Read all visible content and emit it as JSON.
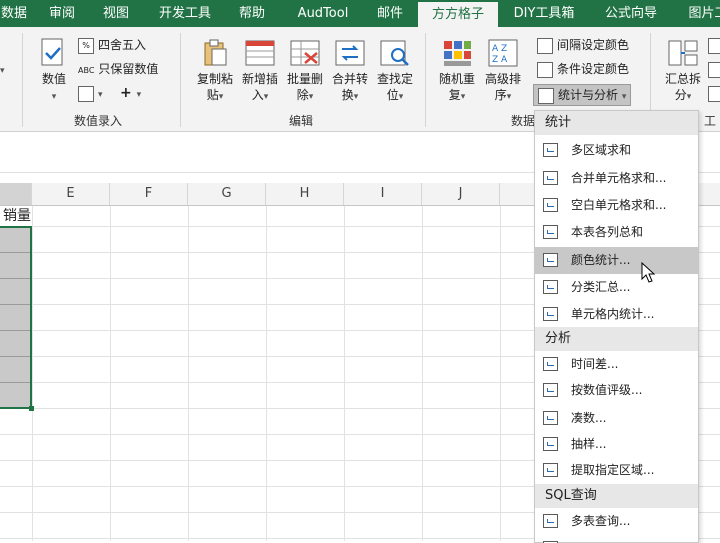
{
  "tabs": [
    {
      "label": "数据",
      "active": false
    },
    {
      "label": "审阅",
      "active": false
    },
    {
      "label": "视图",
      "active": false
    },
    {
      "label": "开发工具",
      "active": false
    },
    {
      "label": "帮助",
      "active": false
    },
    {
      "label": "AudTool",
      "active": false
    },
    {
      "label": "邮件",
      "active": false
    },
    {
      "label": "方方格子",
      "active": true
    },
    {
      "label": "DIY工具箱",
      "active": false
    },
    {
      "label": "公式向导",
      "active": false
    },
    {
      "label": "图片工",
      "active": false
    }
  ],
  "ribbon": {
    "group_numeric": {
      "label": "数值录入",
      "value_button": "数值",
      "round_button": "四舍五入",
      "keep_values_button": "只保留数值",
      "plus_symbol": "+"
    },
    "group_edit": {
      "label": "编辑",
      "copy_paste": {
        "line1": "复制粘",
        "line2": "贴"
      },
      "new_insert": {
        "line1": "新增插",
        "line2": "入"
      },
      "batch_delete": {
        "line1": "批量删",
        "line2": "除"
      },
      "merge_convert": {
        "line1": "合并转",
        "line2": "换"
      },
      "find_locate": {
        "line1": "查找定",
        "line2": "位"
      }
    },
    "group_data": {
      "label": "数据",
      "random_repeat": {
        "line1": "随机重",
        "line2": "复"
      },
      "advanced_sort": {
        "line1": "高级排",
        "line2": "序"
      },
      "interval_color": "间隔设定颜色",
      "cond_color": "条件设定颜色",
      "stats_analysis": "统计与分析"
    },
    "group_work": {
      "label": "工",
      "summary_split": {
        "line1": "汇总拆",
        "line2": "分"
      }
    }
  },
  "columns": [
    "E",
    "F",
    "G",
    "H",
    "I",
    "J"
  ],
  "cell_header": "销量",
  "menu": {
    "sections": [
      {
        "title": "统计",
        "items": [
          "多区域求和",
          "合并单元格求和...",
          "空白单元格求和...",
          "本表各列总和",
          "颜色统计...",
          "分类汇总...",
          "单元格内统计..."
        ]
      },
      {
        "title": "分析",
        "items": [
          "时间差...",
          "按数值评级...",
          "凑数...",
          "抽样...",
          "提取指定区域..."
        ]
      },
      {
        "title": "SQL查询",
        "items": [
          "多表查询..."
        ]
      }
    ],
    "highlighted": "颜色统计..."
  }
}
